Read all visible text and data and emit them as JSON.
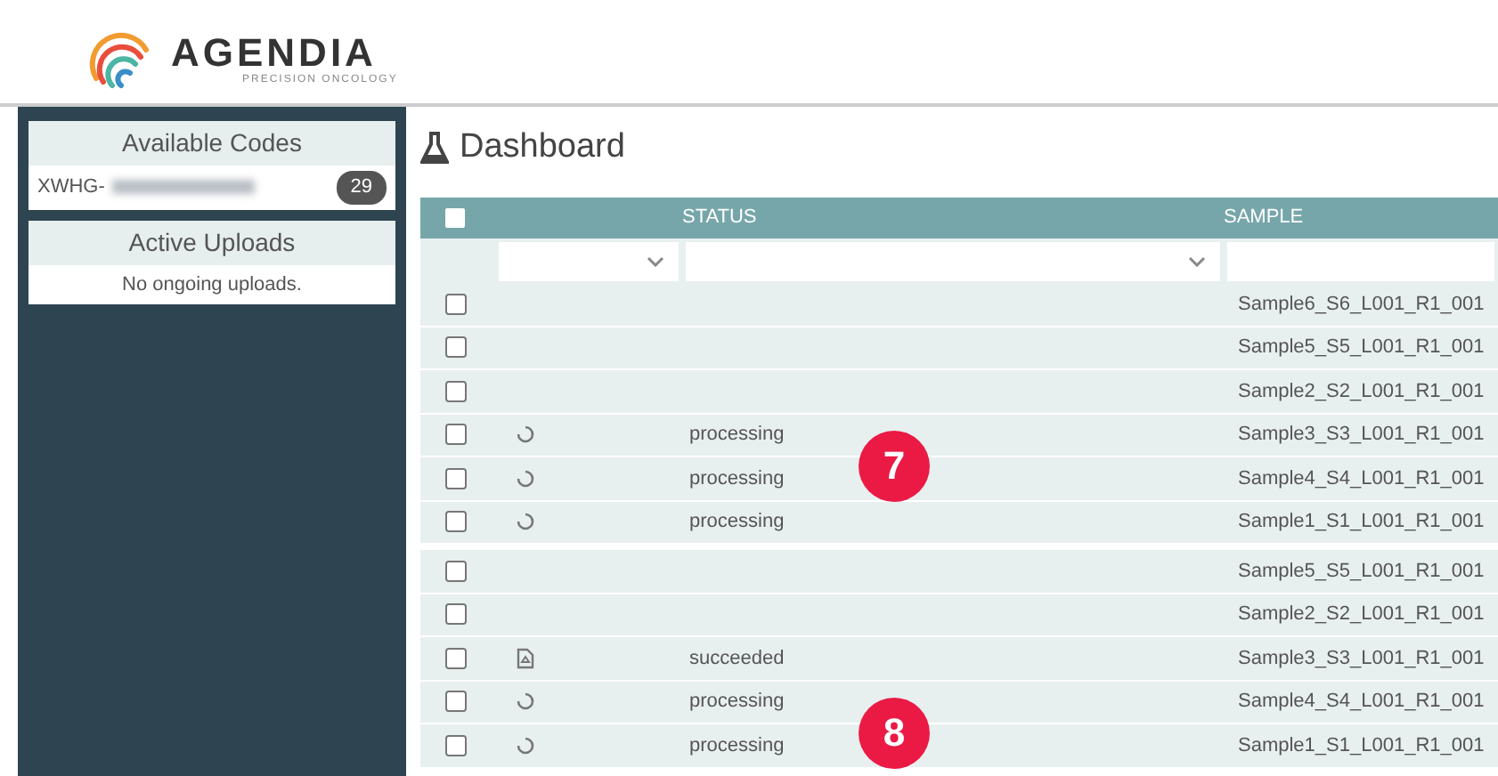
{
  "logo": {
    "name": "AGENDIA",
    "tagline": "PRECISION ONCOLOGY"
  },
  "sidebar": {
    "panels": [
      {
        "title": "Available Codes",
        "kind": "code",
        "code": "XWHG-",
        "count": "29"
      },
      {
        "title": "Active Uploads",
        "kind": "message",
        "message": "No ongoing uploads."
      }
    ]
  },
  "page": {
    "title": "Dashboard"
  },
  "table": {
    "columns": [
      {
        "kind": "check",
        "checked": false
      },
      {
        "kind": "icon"
      },
      {
        "kind": "text",
        "label": "STATUS"
      },
      {
        "kind": "text",
        "label": "SAMPLE"
      }
    ],
    "groups": [
      {
        "callout": "7",
        "rows": [
          {
            "checked": false,
            "kind": "blank",
            "sample": "Sample6_S6_L001_R1_001"
          },
          {
            "checked": false,
            "kind": "blank",
            "sample": "Sample5_S5_L001_R1_001"
          },
          {
            "checked": false,
            "kind": "blank",
            "sample": "Sample2_S2_L001_R1_001"
          },
          {
            "checked": false,
            "kind": "pending",
            "status": "processing",
            "sample": "Sample3_S3_L001_R1_001"
          },
          {
            "checked": false,
            "kind": "pending",
            "status": "processing",
            "sample": "Sample4_S4_L001_R1_001"
          },
          {
            "checked": false,
            "kind": "pending",
            "status": "processing",
            "sample": "Sample1_S1_L001_R1_001"
          }
        ]
      },
      {
        "callout": "8",
        "rows": [
          {
            "checked": false,
            "kind": "blank",
            "sample": "Sample5_S5_L001_R1_001"
          },
          {
            "checked": false,
            "kind": "blank",
            "sample": "Sample2_S2_L001_R1_001"
          },
          {
            "checked": false,
            "kind": "done",
            "status": "succeeded",
            "sample": "Sample3_S3_L001_R1_001"
          },
          {
            "checked": false,
            "kind": "pending",
            "status": "processing",
            "sample": "Sample4_S4_L001_R1_001"
          },
          {
            "checked": false,
            "kind": "pending",
            "status": "processing",
            "sample": "Sample1_S1_L001_R1_001"
          }
        ]
      }
    ]
  }
}
